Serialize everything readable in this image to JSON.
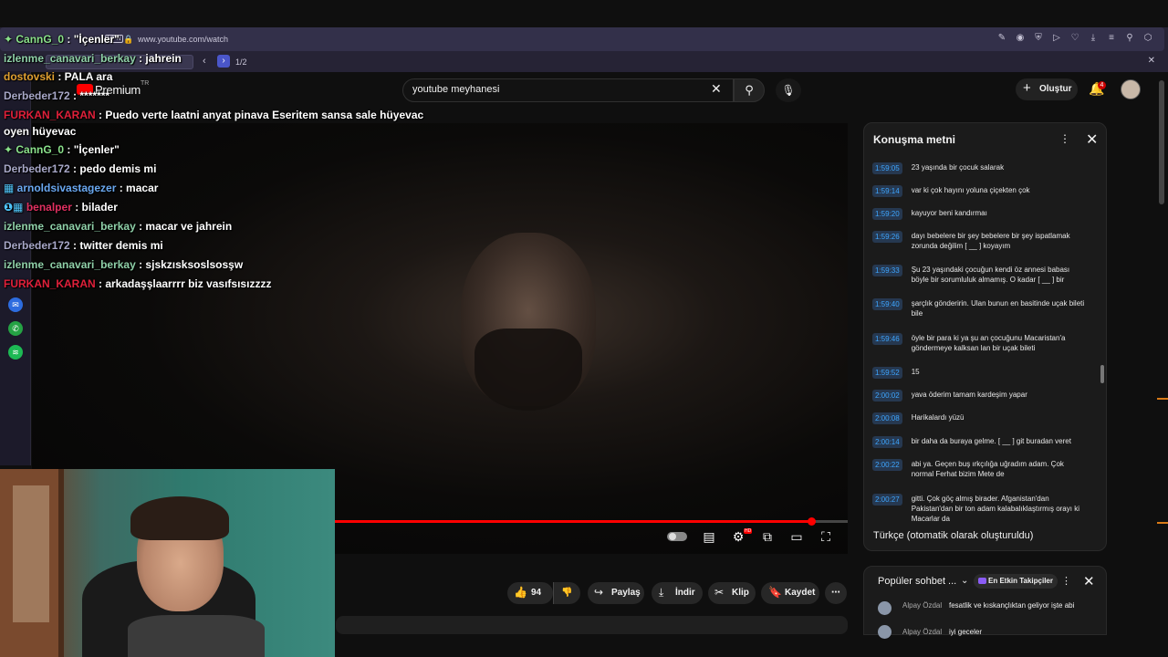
{
  "browser": {
    "url": "www.youtube.com/watch",
    "vpn_label": "VPN",
    "find": {
      "count": "1/2"
    }
  },
  "youtube": {
    "logo_text": "Premium",
    "country": "TR",
    "search": {
      "value": "youtube meyhanesi"
    },
    "create_label": "Oluştur",
    "notification_count": "4"
  },
  "player": {
    "progress_fraction": 0.955
  },
  "actions": {
    "likes": "94",
    "share": "Paylaş",
    "download": "İndir",
    "clip": "Klip",
    "save": "Kaydet"
  },
  "transcript": {
    "title": "Konuşma metni",
    "language": "Türkçe (otomatik olarak oluşturuldu)",
    "rows": [
      {
        "time": "1:59:05",
        "text": "23 yaşında bir çocuk salarak"
      },
      {
        "time": "1:59:14",
        "text": "var ki çok hayını yoluna çiçekten çok"
      },
      {
        "time": "1:59:20",
        "text": "kayuyor beni kandırmaı"
      },
      {
        "time": "1:59:26",
        "text": "dayı bebelere bir şey bebelere bir şey ispatlamak zorunda değilim [ __ ] koyayım"
      },
      {
        "time": "1:59:33",
        "text": "Şu 23 yaşındaki çocuğun kendi öz annesi babası böyle bir sorumluluk almamış. O kadar [ __ ] bir"
      },
      {
        "time": "1:59:40",
        "text": "şarçlık gönderirin. Ulan bunun en basitinde uçak bileti bile"
      },
      {
        "time": "1:59:46",
        "text": "öyle bir para ki ya şu an çocuğunu Macaristan'a göndermeye kalksan lan bir uçak bileti"
      },
      {
        "time": "1:59:52",
        "text": "15"
      },
      {
        "time": "2:00:02",
        "text": "yava öderim tamam kardeşim yapar"
      },
      {
        "time": "2:00:08",
        "text": "Harikalardı yüzü"
      },
      {
        "time": "2:00:14",
        "text": "bir daha da buraya gelme. [ __ ] git buradan veret"
      },
      {
        "time": "2:00:22",
        "text": "abi ya. Geçen buş ırkçılığa uğradım adam. Çok normal Ferhat bizim Mete de"
      },
      {
        "time": "2:00:27",
        "text": "gitti. Çok göç almış birader. Afganistan'dan Pakistan'dan bir ton adam kalabalıklaştırmış orayı ki Macarlar da"
      }
    ]
  },
  "livechat": {
    "title": "Popüler sohbet ...",
    "badge": "En Etkin Takipçiler",
    "messages": [
      {
        "author": "Alpay Özdal",
        "text": "fesatlik ve kıskançlıktan geliyor işte abi"
      },
      {
        "author": "Alpay Özdal",
        "text": "iyi geceler"
      }
    ]
  },
  "stream_chat": [
    {
      "user": "CannG_0",
      "sep": " : ",
      "msg": "\"İçenler\"",
      "color": "#8be28b",
      "badge": "✦"
    },
    {
      "user": "izlenme_canavari_berkay",
      "sep": " : ",
      "msg": "jahrein",
      "color": "#8fd0a8",
      "badge": ""
    },
    {
      "user": "dostovski",
      "sep": " : ",
      "msg": "PALA ara",
      "color": "#e0a030",
      "badge": ""
    },
    {
      "user": "Derbeder172",
      "sep": " : ",
      "msg": "*******",
      "color": "#a8a8c8",
      "badge": ""
    },
    {
      "user": "FURKAN_KARAN",
      "sep": " : ",
      "msg": "Puedo verte laatni anyat pinava Eseritem sansa sale hüyevac",
      "color": "#e0203a",
      "badge": ""
    },
    {
      "user": "",
      "sep": "",
      "msg": "oyen hüyevac",
      "color": "#ffffff",
      "badge": ""
    },
    {
      "user": "CannG_0",
      "sep": " : ",
      "msg": "\"İçenler\"",
      "color": "#8be28b",
      "badge": "✦"
    },
    {
      "user": "Derbeder172",
      "sep": " : ",
      "msg": "pedo demis mi",
      "color": "#a8a8c8",
      "badge": ""
    },
    {
      "user": "arnoldsivastagezer",
      "sep": " : ",
      "msg": "macar",
      "color": "#6aa8f0",
      "badge": "▦"
    },
    {
      "user": "benalper",
      "sep": " : ",
      "msg": "bilader",
      "color": "#e03060",
      "badge": "❶▦"
    },
    {
      "user": "izlenme_canavari_berkay",
      "sep": " : ",
      "msg": "macar ve jahrein",
      "color": "#8fd0a8",
      "badge": ""
    },
    {
      "user": "Derbeder172",
      "sep": " : ",
      "msg": "twitter demis mi",
      "color": "#a8a8c8",
      "badge": ""
    },
    {
      "user": "izlenme_canavari_berkay",
      "sep": " : ",
      "msg": "sjskzısksoslsosşw",
      "color": "#8fd0a8",
      "badge": ""
    },
    {
      "user": "FURKAN_KARAN",
      "sep": " : ",
      "msg": "arkadaşşlaarrrr biz vasıfsısızzzz",
      "color": "#e0203a",
      "badge": ""
    }
  ],
  "colors": {
    "accent": "#ff0000",
    "link": "#3ea6ff",
    "browser": "#262335"
  }
}
